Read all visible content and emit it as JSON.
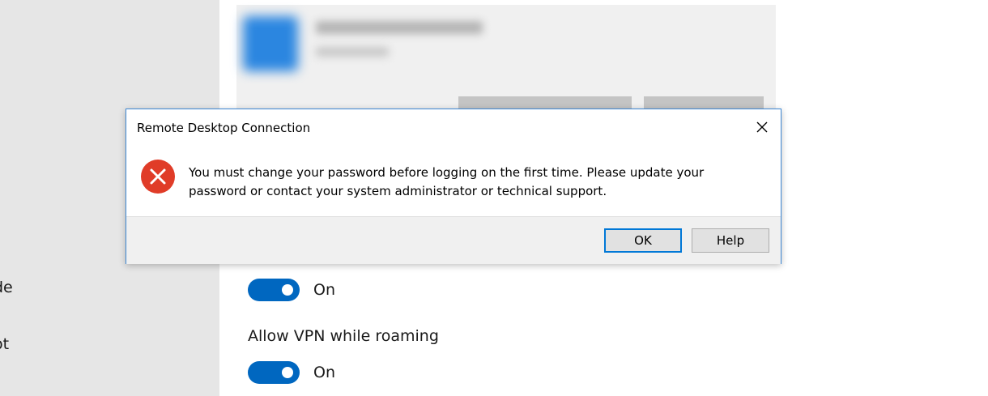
{
  "sidebar": {
    "items": [
      {
        "label": "de"
      },
      {
        "label": "ot"
      }
    ]
  },
  "vpn_settings": {
    "toggle1": {
      "state_label": "On",
      "on": true
    },
    "allow_roaming": {
      "label": "Allow VPN while roaming",
      "state_label": "On",
      "on": true
    }
  },
  "dialog": {
    "title": "Remote Desktop Connection",
    "message": "You must change your password before logging on the first time. Please update your password or contact your system administrator or technical support.",
    "ok_label": "OK",
    "help_label": "Help",
    "icon": "error-icon"
  },
  "colors": {
    "accent": "#0067c0",
    "error": "#e03c28",
    "dialog_border": "#3d87d3"
  }
}
